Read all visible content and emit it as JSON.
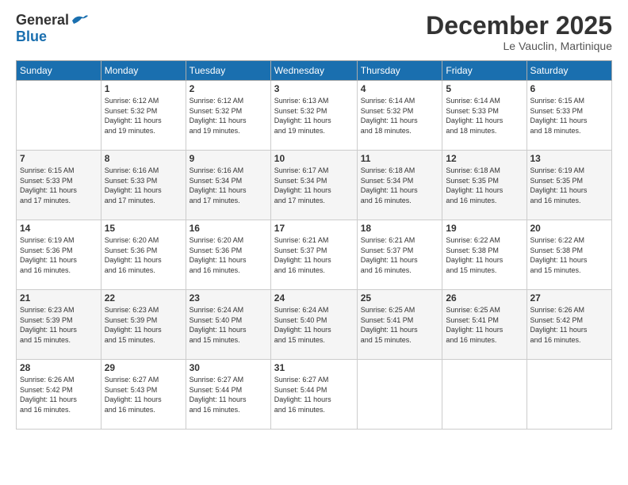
{
  "header": {
    "logo_general": "General",
    "logo_blue": "Blue",
    "month_title": "December 2025",
    "location": "Le Vauclin, Martinique"
  },
  "weekdays": [
    "Sunday",
    "Monday",
    "Tuesday",
    "Wednesday",
    "Thursday",
    "Friday",
    "Saturday"
  ],
  "weeks": [
    [
      {
        "day": "",
        "info": ""
      },
      {
        "day": "1",
        "info": "Sunrise: 6:12 AM\nSunset: 5:32 PM\nDaylight: 11 hours\nand 19 minutes."
      },
      {
        "day": "2",
        "info": "Sunrise: 6:12 AM\nSunset: 5:32 PM\nDaylight: 11 hours\nand 19 minutes."
      },
      {
        "day": "3",
        "info": "Sunrise: 6:13 AM\nSunset: 5:32 PM\nDaylight: 11 hours\nand 19 minutes."
      },
      {
        "day": "4",
        "info": "Sunrise: 6:14 AM\nSunset: 5:32 PM\nDaylight: 11 hours\nand 18 minutes."
      },
      {
        "day": "5",
        "info": "Sunrise: 6:14 AM\nSunset: 5:33 PM\nDaylight: 11 hours\nand 18 minutes."
      },
      {
        "day": "6",
        "info": "Sunrise: 6:15 AM\nSunset: 5:33 PM\nDaylight: 11 hours\nand 18 minutes."
      }
    ],
    [
      {
        "day": "7",
        "info": "Sunrise: 6:15 AM\nSunset: 5:33 PM\nDaylight: 11 hours\nand 17 minutes."
      },
      {
        "day": "8",
        "info": "Sunrise: 6:16 AM\nSunset: 5:33 PM\nDaylight: 11 hours\nand 17 minutes."
      },
      {
        "day": "9",
        "info": "Sunrise: 6:16 AM\nSunset: 5:34 PM\nDaylight: 11 hours\nand 17 minutes."
      },
      {
        "day": "10",
        "info": "Sunrise: 6:17 AM\nSunset: 5:34 PM\nDaylight: 11 hours\nand 17 minutes."
      },
      {
        "day": "11",
        "info": "Sunrise: 6:18 AM\nSunset: 5:34 PM\nDaylight: 11 hours\nand 16 minutes."
      },
      {
        "day": "12",
        "info": "Sunrise: 6:18 AM\nSunset: 5:35 PM\nDaylight: 11 hours\nand 16 minutes."
      },
      {
        "day": "13",
        "info": "Sunrise: 6:19 AM\nSunset: 5:35 PM\nDaylight: 11 hours\nand 16 minutes."
      }
    ],
    [
      {
        "day": "14",
        "info": "Sunrise: 6:19 AM\nSunset: 5:36 PM\nDaylight: 11 hours\nand 16 minutes."
      },
      {
        "day": "15",
        "info": "Sunrise: 6:20 AM\nSunset: 5:36 PM\nDaylight: 11 hours\nand 16 minutes."
      },
      {
        "day": "16",
        "info": "Sunrise: 6:20 AM\nSunset: 5:36 PM\nDaylight: 11 hours\nand 16 minutes."
      },
      {
        "day": "17",
        "info": "Sunrise: 6:21 AM\nSunset: 5:37 PM\nDaylight: 11 hours\nand 16 minutes."
      },
      {
        "day": "18",
        "info": "Sunrise: 6:21 AM\nSunset: 5:37 PM\nDaylight: 11 hours\nand 16 minutes."
      },
      {
        "day": "19",
        "info": "Sunrise: 6:22 AM\nSunset: 5:38 PM\nDaylight: 11 hours\nand 15 minutes."
      },
      {
        "day": "20",
        "info": "Sunrise: 6:22 AM\nSunset: 5:38 PM\nDaylight: 11 hours\nand 15 minutes."
      }
    ],
    [
      {
        "day": "21",
        "info": "Sunrise: 6:23 AM\nSunset: 5:39 PM\nDaylight: 11 hours\nand 15 minutes."
      },
      {
        "day": "22",
        "info": "Sunrise: 6:23 AM\nSunset: 5:39 PM\nDaylight: 11 hours\nand 15 minutes."
      },
      {
        "day": "23",
        "info": "Sunrise: 6:24 AM\nSunset: 5:40 PM\nDaylight: 11 hours\nand 15 minutes."
      },
      {
        "day": "24",
        "info": "Sunrise: 6:24 AM\nSunset: 5:40 PM\nDaylight: 11 hours\nand 15 minutes."
      },
      {
        "day": "25",
        "info": "Sunrise: 6:25 AM\nSunset: 5:41 PM\nDaylight: 11 hours\nand 15 minutes."
      },
      {
        "day": "26",
        "info": "Sunrise: 6:25 AM\nSunset: 5:41 PM\nDaylight: 11 hours\nand 16 minutes."
      },
      {
        "day": "27",
        "info": "Sunrise: 6:26 AM\nSunset: 5:42 PM\nDaylight: 11 hours\nand 16 minutes."
      }
    ],
    [
      {
        "day": "28",
        "info": "Sunrise: 6:26 AM\nSunset: 5:42 PM\nDaylight: 11 hours\nand 16 minutes."
      },
      {
        "day": "29",
        "info": "Sunrise: 6:27 AM\nSunset: 5:43 PM\nDaylight: 11 hours\nand 16 minutes."
      },
      {
        "day": "30",
        "info": "Sunrise: 6:27 AM\nSunset: 5:44 PM\nDaylight: 11 hours\nand 16 minutes."
      },
      {
        "day": "31",
        "info": "Sunrise: 6:27 AM\nSunset: 5:44 PM\nDaylight: 11 hours\nand 16 minutes."
      },
      {
        "day": "",
        "info": ""
      },
      {
        "day": "",
        "info": ""
      },
      {
        "day": "",
        "info": ""
      }
    ]
  ]
}
